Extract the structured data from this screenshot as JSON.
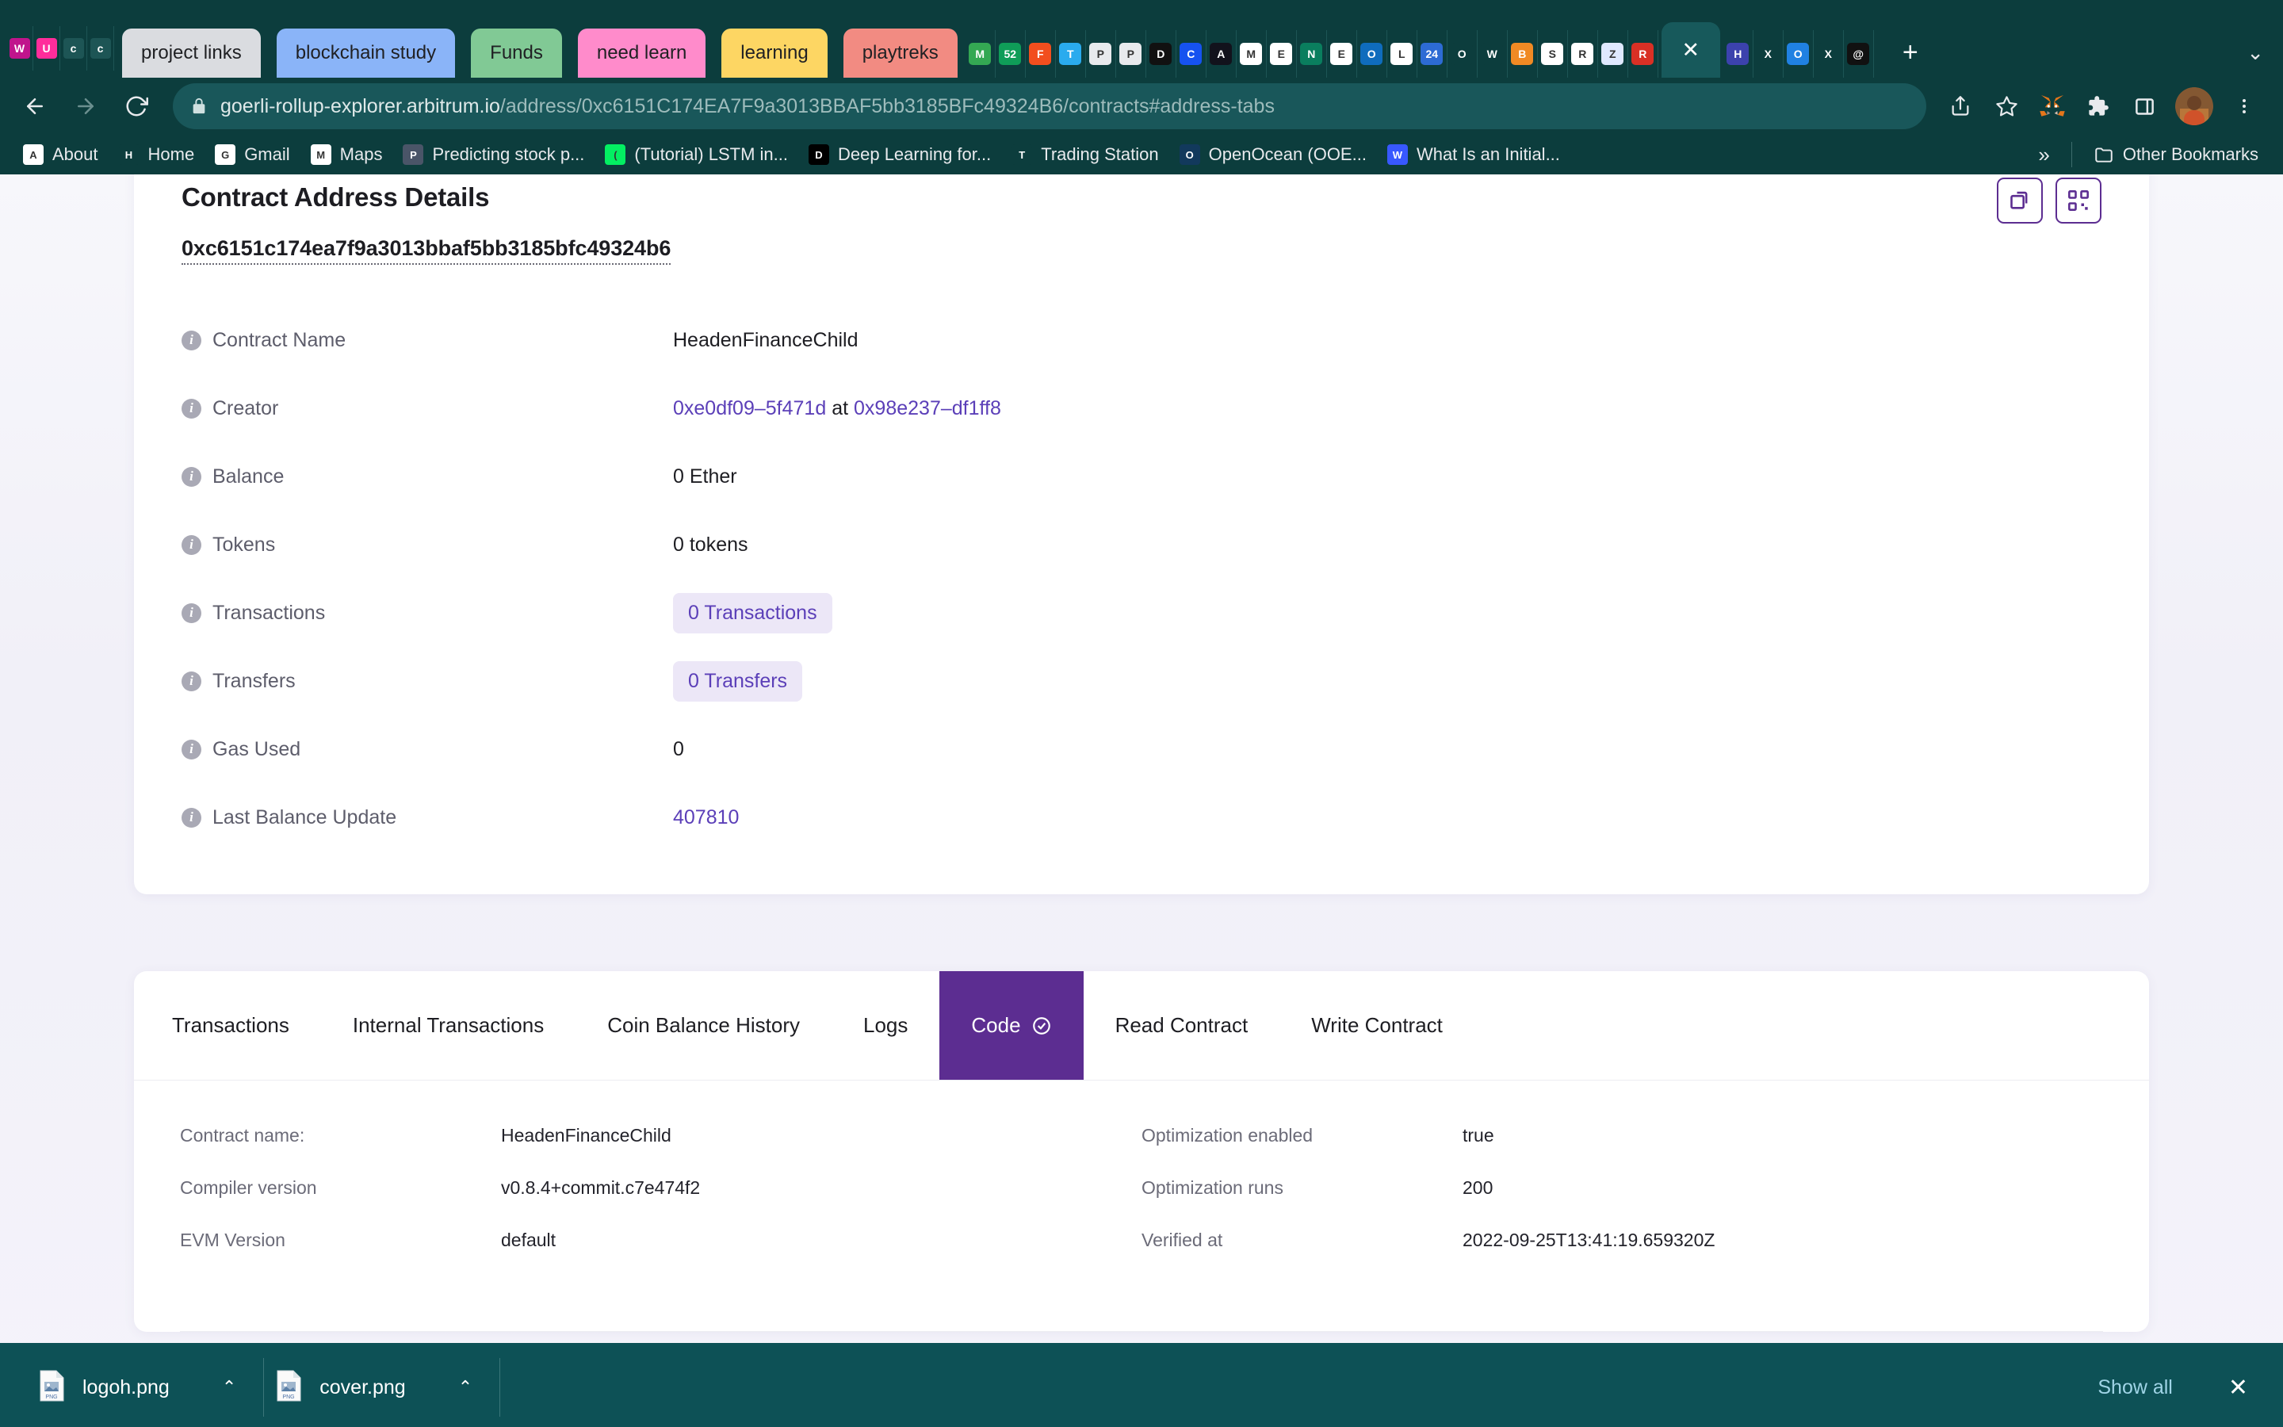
{
  "browser": {
    "tab_groups": [
      {
        "label": "project links",
        "color": "#dadce0"
      },
      {
        "label": "blockchain study",
        "color": "#8ab4f8"
      },
      {
        "label": "Funds",
        "color": "#81c995"
      },
      {
        "label": "need learn",
        "color": "#ff8bcb"
      },
      {
        "label": "learning",
        "color": "#fdd663"
      },
      {
        "label": "playtreks",
        "color": "#f28b82"
      }
    ],
    "pinned_tabs": [
      {
        "name": "wyre-tab",
        "color": "#c0148c",
        "letter": "W"
      },
      {
        "name": "unicorn-tab",
        "color": "#ff2d9b",
        "letter": "U"
      },
      {
        "name": "doc-tab-1",
        "color": "#1d5555",
        "letter": "c"
      },
      {
        "name": "doc-tab-2",
        "color": "#1d5555",
        "letter": "c"
      }
    ],
    "favicon_tabs": [
      {
        "name": "google-maps-tab",
        "color": "#34a853",
        "letter": "M"
      },
      {
        "name": "counter-tab",
        "color": "#0f9d58",
        "letter": "52"
      },
      {
        "name": "figma-tab",
        "color": "#f24e1e",
        "letter": "F"
      },
      {
        "name": "telegram-tab",
        "color": "#2aabee",
        "letter": "T"
      },
      {
        "name": "parachute-tab-1",
        "color": "#e8eaed",
        "letter": "P"
      },
      {
        "name": "parachute-tab-2",
        "color": "#e8eaed",
        "letter": "P"
      },
      {
        "name": "black-drop-tab",
        "color": "#111111",
        "letter": "D"
      },
      {
        "name": "coinbase-tab",
        "color": "#1652f0",
        "letter": "C"
      },
      {
        "name": "flame-tab",
        "color": "#12121c",
        "letter": "A"
      },
      {
        "name": "gmail-tab",
        "color": "#ffffff",
        "letter": "M"
      },
      {
        "name": "etherscan-tab-1",
        "color": "#ffffff",
        "letter": "E"
      },
      {
        "name": "green-tab",
        "color": "#0a7e5e",
        "letter": "N"
      },
      {
        "name": "etherscan-tab-2",
        "color": "#ffffff",
        "letter": "E"
      },
      {
        "name": "outlook-tab",
        "color": "#0f6cbd",
        "letter": "O"
      },
      {
        "name": "chain-tab",
        "color": "#ffffff",
        "letter": "L"
      },
      {
        "name": "calendar24-tab",
        "color": "#2d6bd4",
        "letter": "24"
      },
      {
        "name": "sunburst-tab",
        "color": "#0c3d3d",
        "letter": "O"
      },
      {
        "name": "wave-tab",
        "color": "#0c3d3d",
        "letter": "W"
      },
      {
        "name": "orange-pill-tab",
        "color": "#f08a24",
        "letter": "B"
      },
      {
        "name": "opensea-tab",
        "color": "#ffffff",
        "letter": "S"
      },
      {
        "name": "rocket-tab",
        "color": "#ffffff",
        "letter": "R"
      },
      {
        "name": "zapper-tab",
        "color": "#dfe9ff",
        "letter": "Z"
      },
      {
        "name": "red-tab",
        "color": "#d93025",
        "letter": "R"
      },
      {
        "name": "violet-tab-1",
        "color": "#0c3d3d",
        "letter": "X"
      },
      {
        "name": "hex-tab",
        "color": "#3c42ad",
        "letter": "H"
      },
      {
        "name": "violet-tab-2",
        "color": "#0c3d3d",
        "letter": "X"
      },
      {
        "name": "opensea-blue-tab",
        "color": "#2081e2",
        "letter": "O"
      },
      {
        "name": "violet-tab-3",
        "color": "#0c3d3d",
        "letter": "X"
      },
      {
        "name": "spiral-tab",
        "color": "#111111",
        "letter": "@"
      }
    ],
    "active_tab_index": 23,
    "new_tab_label": "+",
    "tab_list_chevron": "⌄",
    "nav": {
      "back": "←",
      "forward": "→",
      "reload": "⟳"
    },
    "url": {
      "scheme_icon": "lock-icon",
      "domain": "goerli-rollup-explorer.arbitrum.io",
      "path": "/address/0xc6151C174EA7F9a3013BBAF5bb3185BFc49324B6/contracts#address-tabs"
    },
    "toolbar_icons": [
      "share-icon",
      "bookmark-star-icon",
      "metamask-icon",
      "extensions-icon",
      "side-panel-icon",
      "profile-avatar",
      "chrome-menu-icon"
    ],
    "bookmarks": [
      {
        "label": "About",
        "icon": "google-icon",
        "color": "#ffffff"
      },
      {
        "label": "Home",
        "icon": "twitter-icon",
        "color": "#0c3d3d"
      },
      {
        "label": "Gmail",
        "icon": "gmail-icon",
        "color": "#ffffff"
      },
      {
        "label": "Maps",
        "icon": "maps-icon",
        "color": "#ffffff"
      },
      {
        "label": "Predicting stock p...",
        "icon": "towardsdatascience-icon",
        "color": "#4a5568"
      },
      {
        "label": "(Tutorial) LSTM in...",
        "icon": "datacamp-icon",
        "color": "#03ef62"
      },
      {
        "label": "Deep Learning for...",
        "icon": "medium-icon",
        "color": "#000000"
      },
      {
        "label": "Trading Station",
        "icon": "trading-station-icon",
        "color": "#0c3d3d"
      },
      {
        "label": "OpenOcean (OOE...",
        "icon": "openocean-icon",
        "color": "#12395c"
      },
      {
        "label": "What Is an Initial...",
        "icon": "investopedia-icon",
        "color": "#3858ff"
      }
    ],
    "bookmarks_overflow_label": "»",
    "other_bookmarks_label": "Other Bookmarks"
  },
  "address_card": {
    "title": "Contract Address Details",
    "hash": "0xc6151c174ea7f9a3013bbaf5bb3185bfc49324b6",
    "action_buttons": [
      {
        "name": "copy-address-button",
        "icon": "copy-icon"
      },
      {
        "name": "qr-code-button",
        "icon": "qr-code-icon"
      }
    ],
    "rows": [
      {
        "label": "Contract Name",
        "value": "HeadenFinanceChild",
        "type": "text"
      },
      {
        "label": "Creator",
        "type": "creator",
        "creator_address": "0xe0df09–5f471d",
        "at_word": "at",
        "tx_hash": "0x98e237–df1ff8"
      },
      {
        "label": "Balance",
        "value": "0 Ether",
        "type": "text"
      },
      {
        "label": "Tokens",
        "value": "0 tokens",
        "type": "text"
      },
      {
        "label": "Transactions",
        "value": "0 Transactions",
        "type": "pill"
      },
      {
        "label": "Transfers",
        "value": "0 Transfers",
        "type": "pill"
      },
      {
        "label": "Gas Used",
        "value": "0",
        "type": "text"
      },
      {
        "label": "Last Balance Update",
        "value": "407810",
        "type": "link"
      }
    ]
  },
  "tabs_card": {
    "tabs": [
      {
        "label": "Transactions",
        "active": false,
        "check": false
      },
      {
        "label": "Internal Transactions",
        "active": false,
        "check": false
      },
      {
        "label": "Coin Balance History",
        "active": false,
        "check": false
      },
      {
        "label": "Logs",
        "active": false,
        "check": false
      },
      {
        "label": "Code",
        "active": true,
        "check": true
      },
      {
        "label": "Read Contract",
        "active": false,
        "check": false
      },
      {
        "label": "Write Contract",
        "active": false,
        "check": false
      }
    ],
    "meta_left": [
      {
        "key": "Contract name:",
        "value": "HeadenFinanceChild"
      },
      {
        "key": "Compiler version",
        "value": "v0.8.4+commit.c7e474f2"
      },
      {
        "key": "EVM Version",
        "value": "default"
      }
    ],
    "meta_right": [
      {
        "key": "Optimization enabled",
        "value": "true"
      },
      {
        "key": "Optimization runs",
        "value": "200"
      },
      {
        "key": "Verified at",
        "value": "2022-09-25T13:41:19.659320Z"
      }
    ]
  },
  "downloads": {
    "items": [
      {
        "name": "logoh.png",
        "caret": "⌃"
      },
      {
        "name": "cover.png",
        "caret": "⌃"
      }
    ],
    "show_all_label": "Show all",
    "close_label": "✕"
  },
  "colors": {
    "chrome_bg": "#0c3d3d",
    "accent_purple": "#5c2d91",
    "link_purple": "#5b3fb8",
    "download_bar": "#0d5156"
  }
}
